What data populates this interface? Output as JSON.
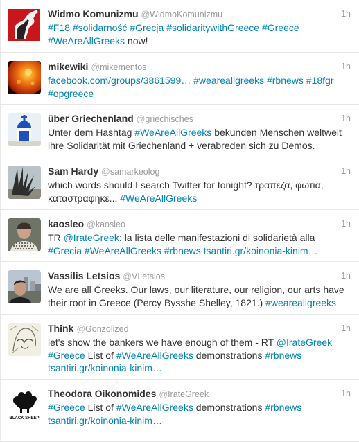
{
  "tweets": [
    {
      "name": "Widmo Komunizmu",
      "handle": "WidmoKomunizmu",
      "time": "1h",
      "avatar_icon": "red-raised-fist-icon",
      "lines": [
        [
          {
            "t": "#F18",
            "link": true
          },
          {
            "t": " "
          },
          {
            "t": "#solidarność",
            "link": true
          },
          {
            "t": " "
          },
          {
            "t": "#Grecja",
            "link": true
          },
          {
            "t": " "
          },
          {
            "t": "#solidaritywithGreece",
            "link": true
          },
          {
            "t": " "
          },
          {
            "t": "#Greece",
            "link": true
          }
        ],
        [
          {
            "t": "#WeAreAllGreeks",
            "link": true
          },
          {
            "t": " now!"
          }
        ]
      ]
    },
    {
      "name": "mikewiki",
      "handle": "mikementos",
      "time": "1h",
      "avatar_icon": "sun-flare-icon",
      "lines": [
        [
          {
            "t": "facebook.com/groups/3861599…",
            "link": true
          },
          {
            "t": " "
          },
          {
            "t": "#weareallgreeks",
            "link": true
          },
          {
            "t": " "
          },
          {
            "t": "#rbnews",
            "link": true
          },
          {
            "t": " "
          },
          {
            "t": "#18fgr",
            "link": true
          }
        ],
        [
          {
            "t": "#opgreece",
            "link": true
          }
        ]
      ]
    },
    {
      "name": "über Griechenland",
      "handle": "griechisches",
      "time": "1h",
      "avatar_icon": "blue-chapel-dome-icon",
      "lines": [
        [
          {
            "t": "Unter dem Hashtag "
          },
          {
            "t": "#WeAreAllGreeks",
            "link": true
          },
          {
            "t": " bekunden Menschen weltweit"
          }
        ],
        [
          {
            "t": "ihre Solidarität mit Griechenland + verabreden sich zu Demos."
          }
        ]
      ]
    },
    {
      "name": "Sam Hardy",
      "handle": "samarkeolog",
      "time": "1h",
      "avatar_icon": "spiky-sculpture-icon",
      "lines": [
        [
          {
            "t": "which words should I search Twitter for tonight? τραπεζα, φωτια,"
          }
        ],
        [
          {
            "t": "καταστραφηκε... "
          },
          {
            "t": "#WeAreAllGreeks",
            "link": true
          }
        ]
      ]
    },
    {
      "name": "kaosleo",
      "handle": "kaosleo",
      "time": "1h",
      "avatar_icon": "person-keffiyeh-icon",
      "lines": [
        [
          {
            "t": "TR "
          },
          {
            "t": "@IrateGreek",
            "link": true
          },
          {
            "t": ": la lista delle manifestazioni di solidarietà alla"
          }
        ],
        [
          {
            "t": "#Grecia",
            "link": true
          },
          {
            "t": " "
          },
          {
            "t": "#WeAreAllGreeks",
            "link": true
          },
          {
            "t": " "
          },
          {
            "t": "#rbnews",
            "link": true
          },
          {
            "t": " "
          },
          {
            "t": "tsantiri.gr/koinonia-kinim…",
            "link": true
          }
        ]
      ]
    },
    {
      "name": "Vassilis Letsios",
      "handle": "VLetsios",
      "time": "1h",
      "avatar_icon": "person-city-icon",
      "lines": [
        [
          {
            "t": "We are all Greeks. Our laws, our literature, our religion, our arts have"
          }
        ],
        [
          {
            "t": "their root in Greece (Percy Bysshe Shelley, 1821.) "
          },
          {
            "t": "#weareallgreeks",
            "link": true
          }
        ]
      ]
    },
    {
      "name": "Think",
      "handle": "Gonzolized",
      "time": "1h",
      "avatar_icon": "sketch-portrait-icon",
      "lines": [
        [
          {
            "t": "let's show the bankers we have enough of them - RT "
          },
          {
            "t": "@IrateGreek",
            "link": true
          }
        ],
        [
          {
            "t": "#Greece",
            "link": true
          },
          {
            "t": " List of "
          },
          {
            "t": "#WeAreAllGreeks",
            "link": true
          },
          {
            "t": " demonstrations "
          },
          {
            "t": "#rbnews",
            "link": true
          }
        ],
        [
          {
            "t": "tsantiri.gr/koinonia-kinim…",
            "link": true
          }
        ]
      ]
    },
    {
      "name": "Theodora Oikonomides",
      "handle": "IrateGreek",
      "time": "1h",
      "avatar_icon": "black-sheep-icon",
      "avatar_caption": "BLACK SHEEP",
      "lines": [
        [
          {
            "t": "#Greece",
            "link": true
          },
          {
            "t": " List of "
          },
          {
            "t": "#WeAreAllGreeks",
            "link": true
          },
          {
            "t": " demonstrations "
          },
          {
            "t": "#rbnews",
            "link": true
          }
        ],
        [
          {
            "t": "tsantiri.gr/koinonia-kinim…",
            "link": true
          }
        ]
      ]
    }
  ]
}
